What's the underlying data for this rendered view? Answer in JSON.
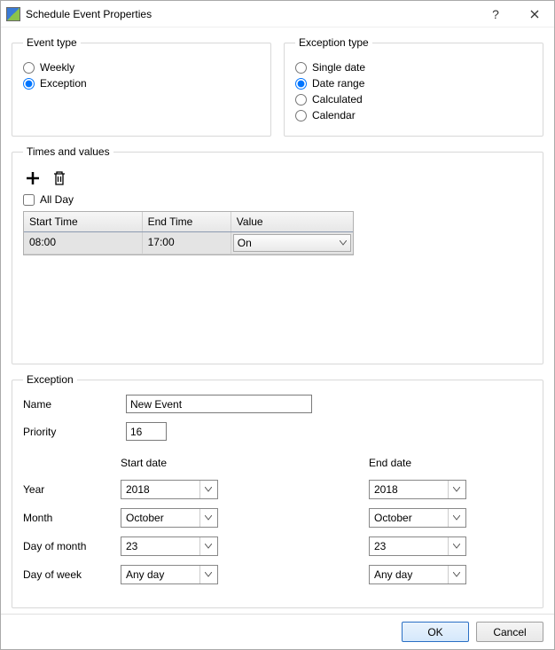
{
  "window": {
    "title": "Schedule Event Properties"
  },
  "event_type": {
    "legend": "Event type",
    "options": {
      "weekly": "Weekly",
      "exception": "Exception"
    },
    "selected": "exception"
  },
  "exception_type": {
    "legend": "Exception type",
    "options": {
      "single_date": "Single date",
      "date_range": "Date range",
      "calculated": "Calculated",
      "calendar": "Calendar"
    },
    "selected": "date_range"
  },
  "times_values": {
    "legend": "Times and values",
    "all_day_label": "All Day",
    "all_day_checked": false,
    "columns": {
      "start": "Start Time",
      "end": "End Time",
      "value": "Value"
    },
    "rows": [
      {
        "start": "08:00",
        "end": "17:00",
        "value": "On"
      }
    ]
  },
  "exception": {
    "legend": "Exception",
    "name_label": "Name",
    "name_value": "New Event",
    "priority_label": "Priority",
    "priority_value": "16",
    "start_header": "Start date",
    "end_header": "End date",
    "rows": {
      "year": {
        "label": "Year",
        "start": "2018",
        "end": "2018"
      },
      "month": {
        "label": "Month",
        "start": "October",
        "end": "October"
      },
      "dom": {
        "label": "Day of month",
        "start": "23",
        "end": "23"
      },
      "dow": {
        "label": "Day of week",
        "start": "Any day",
        "end": "Any day"
      }
    }
  },
  "buttons": {
    "ok": "OK",
    "cancel": "Cancel"
  }
}
